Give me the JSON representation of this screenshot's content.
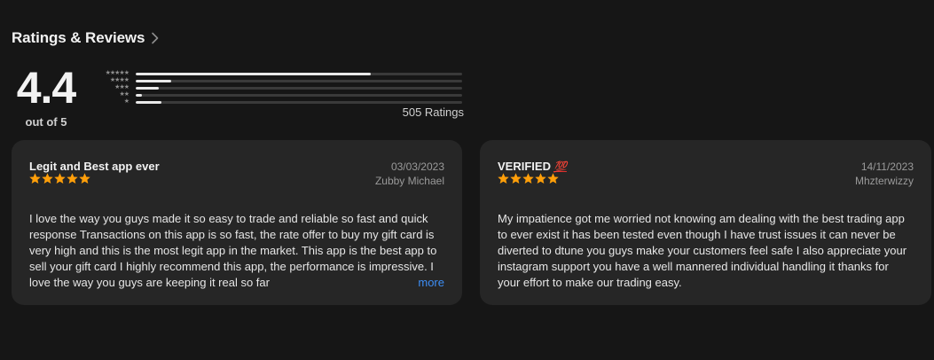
{
  "section": {
    "title": "Ratings & Reviews"
  },
  "summary": {
    "average": "4.4",
    "out_of": "out of 5",
    "ratings_count": "505 Ratings",
    "histogram": [
      {
        "stars": 5,
        "fraction": 0.72
      },
      {
        "stars": 4,
        "fraction": 0.11
      },
      {
        "stars": 3,
        "fraction": 0.07
      },
      {
        "stars": 2,
        "fraction": 0.02
      },
      {
        "stars": 1,
        "fraction": 0.08
      }
    ]
  },
  "reviews": [
    {
      "title": "Legit and Best app ever",
      "date": "03/03/2023",
      "author": "Zubby Michael",
      "rating": 5,
      "body": "I love the way you guys made it so easy to trade and reliable  so fast and quick response Transactions on this app is so fast, the rate offer to buy my gift card is very high and this is the most legit app in the market. This app is the best app to sell your gift card I highly recommend this app, the performance is impressive. I love the way you guys are keeping it real so far",
      "more_label": "more"
    },
    {
      "title": "VERIFIED",
      "title_emoji": "💯",
      "date": "14/11/2023",
      "author": "Mhzterwizzy",
      "rating": 5,
      "body": "My impatience got me worried not knowing am dealing with the best trading app to ever exist it has been tested even though I have trust issues it can never be diverted to dtune you guys make your customers feel safe I also appreciate your instagram support you have a well mannered individual handling it thanks for your effort to make our trading easy."
    }
  ],
  "colors": {
    "background": "#161616",
    "card": "#262626",
    "star": "#ff9f0a",
    "link": "#3d8ef5"
  },
  "icons": {
    "header_chevron": "chevron-right-icon",
    "star": "star-icon"
  }
}
